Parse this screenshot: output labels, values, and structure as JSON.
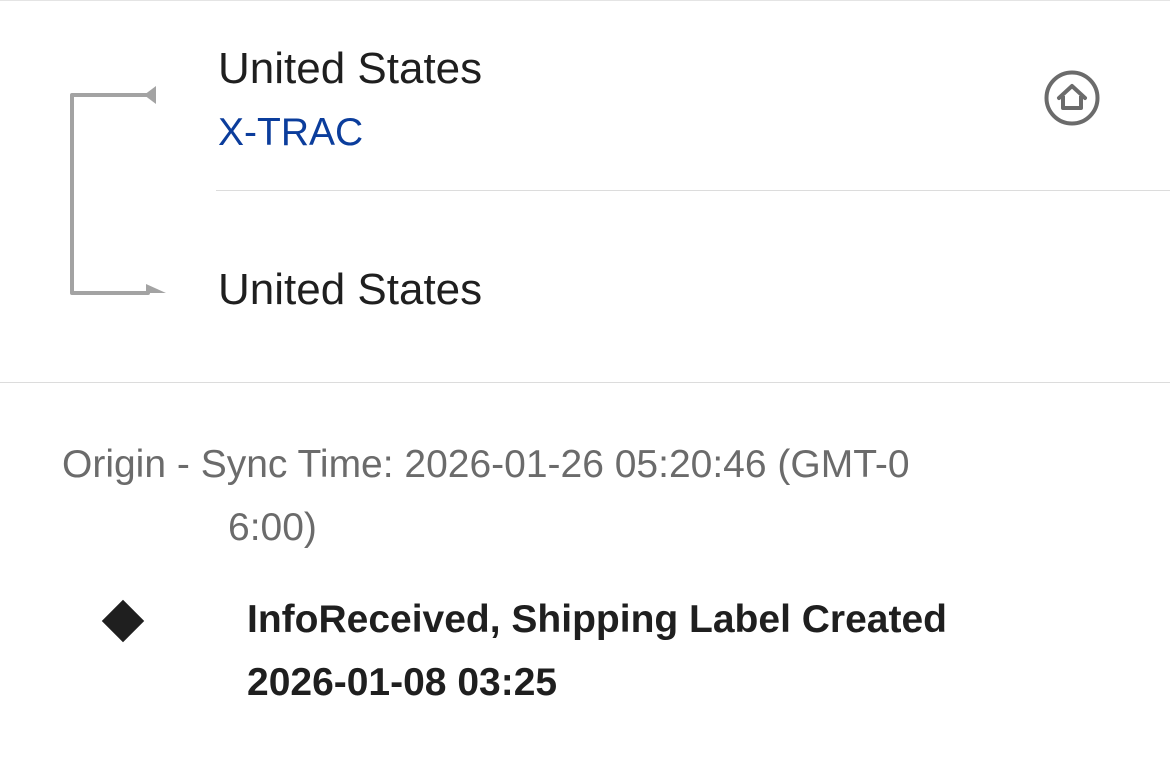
{
  "route": {
    "origin_country": "United States",
    "carrier": "X-TRAC",
    "destination_country": "United States",
    "home_icon": "home-icon"
  },
  "origin_section": {
    "sync_line_1": "Origin - Sync Time: 2026-01-26 05:20:46 (GMT-0",
    "sync_line_2": "6:00)"
  },
  "events": [
    {
      "status": "InfoReceived, Shipping Label Created",
      "time": "2026-01-08 03:25"
    }
  ],
  "colors": {
    "carrier_link": "#0b3d9c",
    "primary_text": "#1f1f1f",
    "secondary_text": "#6b6b6b",
    "connector": "#a3a3a3"
  }
}
